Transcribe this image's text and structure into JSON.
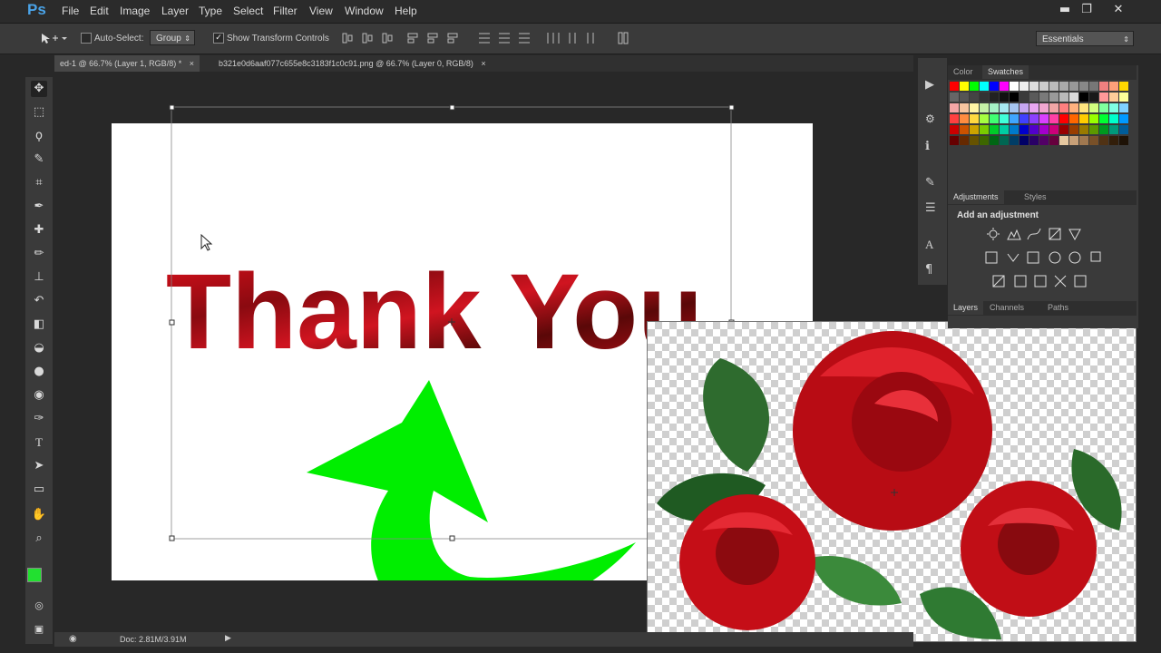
{
  "app": {
    "logo": "Ps"
  },
  "menu": [
    "File",
    "Edit",
    "Image",
    "Layer",
    "Type",
    "Select",
    "Filter",
    "View",
    "Window",
    "Help"
  ],
  "window_controls": {
    "minimize": "▬",
    "restore": "❐",
    "close": "✕"
  },
  "options_bar": {
    "auto_select_label": "Auto-Select:",
    "auto_select_value": "Group",
    "show_transform_label": "Show Transform Controls",
    "workspace": "Essentials"
  },
  "tabs": [
    {
      "label": "ed-1 @ 66.7% (Layer 1, RGB/8) *",
      "close": "×"
    },
    {
      "label": "b321e0d6aaf077c655e8c3183f1c0c91.png @ 66.7% (Layer 0, RGB/8)",
      "close": "×"
    }
  ],
  "canvas_text": "Thank You",
  "status": {
    "doc": "Doc: 2.81M/3.91M"
  },
  "panels": {
    "color_tab": "Color",
    "swatches_tab": "Swatches",
    "adjustments_tab": "Adjustments",
    "styles_tab": "Styles",
    "add_adjustment": "Add an adjustment",
    "layers_tab": "Layers",
    "channels_tab": "Channels",
    "paths_tab": "Paths"
  },
  "colors": {
    "foreground": "#22e030",
    "background": "#1a1a1a",
    "arrow": "#00ee00",
    "rose": "#c8101a"
  },
  "icons": [
    "move-icon",
    "marquee-icon",
    "lasso-icon",
    "quick-select-icon",
    "crop-icon",
    "eyedropper-icon",
    "healing-icon",
    "brush-icon",
    "stamp-icon",
    "history-brush-icon",
    "eraser-icon",
    "bucket-icon",
    "blur-icon",
    "dodge-icon",
    "pen-icon",
    "type-icon",
    "path-select-icon",
    "shape-icon",
    "hand-icon",
    "zoom-icon"
  ]
}
